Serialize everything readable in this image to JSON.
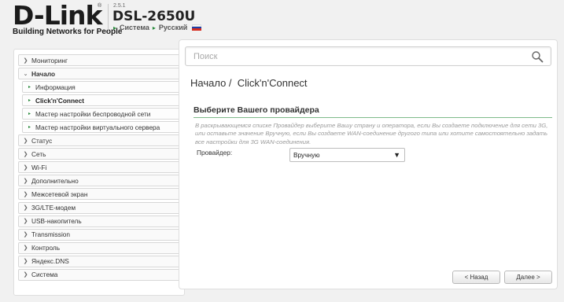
{
  "header": {
    "brand": "D-Link",
    "reg_mark": "®",
    "tagline": "Building Networks for People",
    "version": "2.5.1",
    "model": "DSL-2650U",
    "links": [
      "Система",
      "Русский"
    ],
    "accent": "#2a8a3c"
  },
  "sidebar": {
    "items": [
      {
        "label": "Мониторинг",
        "icon": "chevron-right-icon",
        "state": "collapsed"
      },
      {
        "label": "Начало",
        "icon": "chevron-down-icon",
        "state": "expanded"
      },
      {
        "label": "Информация",
        "icon": "arrow-right-icon",
        "state": "sub"
      },
      {
        "label": "Click'n'Connect",
        "icon": "arrow-right-icon",
        "state": "sub-active"
      },
      {
        "label": "Мастер настройки беспроводной сети",
        "icon": "arrow-right-icon",
        "state": "sub"
      },
      {
        "label": "Мастер настройки виртуального сервера",
        "icon": "arrow-right-icon",
        "state": "sub"
      },
      {
        "label": "Статус",
        "icon": "chevron-right-icon",
        "state": "collapsed"
      },
      {
        "label": "Сеть",
        "icon": "chevron-right-icon",
        "state": "collapsed"
      },
      {
        "label": "Wi-Fi",
        "icon": "chevron-right-icon",
        "state": "collapsed"
      },
      {
        "label": "Дополнительно",
        "icon": "chevron-right-icon",
        "state": "collapsed"
      },
      {
        "label": "Межсетевой экран",
        "icon": "chevron-right-icon",
        "state": "collapsed"
      },
      {
        "label": "3G/LTE-модем",
        "icon": "chevron-right-icon",
        "state": "collapsed"
      },
      {
        "label": "USB-накопитель",
        "icon": "chevron-right-icon",
        "state": "collapsed"
      },
      {
        "label": "Transmission",
        "icon": "chevron-right-icon",
        "state": "collapsed"
      },
      {
        "label": "Контроль",
        "icon": "chevron-right-icon",
        "state": "collapsed"
      },
      {
        "label": "Яндекс.DNS",
        "icon": "chevron-right-icon",
        "state": "collapsed"
      },
      {
        "label": "Система",
        "icon": "chevron-right-icon",
        "state": "collapsed"
      }
    ]
  },
  "search": {
    "placeholder": "Поиск",
    "icon": "search-icon"
  },
  "main": {
    "breadcrumb_root": "Начало /",
    "breadcrumb_page": "Click'n'Connect",
    "section_title": "Выберите Вашего провайдера",
    "description": "В раскрывающемся списке Провайдер выберите Вашу страну и оператора, если Вы создаете подключение для сети 3G, или оставьте значение Вручную, если Вы создаете WAN-соединение другого типа или хотите самостоятельно задать все настройки для 3G WAN-соединения.",
    "provider_label": "Провайдер:",
    "provider_value": "Вручную",
    "back_label": "< Назад",
    "next_label": "Далее >"
  },
  "colors": {
    "section_underline": "#7fba8a",
    "flag": [
      "#ffffff",
      "#1c3fa8",
      "#d52b1e"
    ]
  }
}
